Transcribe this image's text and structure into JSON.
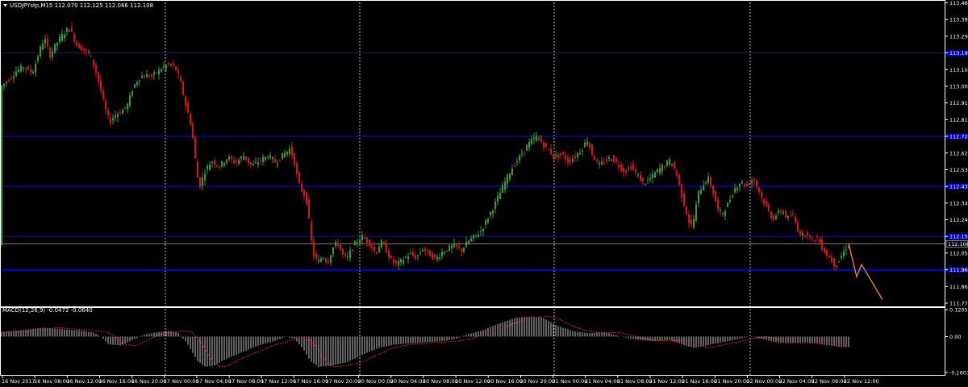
{
  "chart_data": [
    {
      "type": "candlestick",
      "title": "USDJPYstp,M15  112.070 112.125 112.066 112.108",
      "symbol": "USDJPYstp",
      "timeframe": "M15",
      "ohlc_header": [
        112.07,
        112.125,
        112.066,
        112.108
      ],
      "current_price": 112.108,
      "ylim": [
        111.77,
        113.48
      ],
      "y_ticks": [
        "113.480",
        "113.385",
        "113.290",
        "113.195",
        "113.100",
        "113.005",
        "112.910",
        "112.815",
        "112.720",
        "112.625",
        "112.530",
        "112.435",
        "112.340",
        "112.245",
        "112.150",
        "112.055",
        "111.960",
        "111.865",
        "111.770"
      ],
      "x_labels": [
        "16 Nov 2017",
        "16 Nov 08:00",
        "16 Nov 12:00",
        "16 Nov 16:00",
        "16 Nov 20:00",
        "17 Nov 00:00",
        "17 Nov 04:00",
        "17 Nov 08:00",
        "17 Nov 12:00",
        "17 Nov 16:00",
        "17 Nov 20:00",
        "20 Nov 00:00",
        "20 Nov 04:00",
        "20 Nov 08:00",
        "20 Nov 12:00",
        "20 Nov 16:00",
        "20 Nov 20:00",
        "21 Nov 00:00",
        "21 Nov 04:00",
        "21 Nov 08:00",
        "21 Nov 12:00",
        "21 Nov 16:00",
        "21 Nov 20:00",
        "22 Nov 00:00",
        "22 Nov 04:00",
        "22 Nov 08:00",
        "22 Nov 12:00"
      ],
      "period_separators": [
        "17 Nov 00:00",
        "20 Nov 00:00",
        "20 Nov 20:00",
        "22 Nov 00:00"
      ],
      "horizontal_levels": [
        113.195,
        112.72,
        112.435,
        112.15,
        111.96
      ],
      "price_path": [
        [
          0,
          113.0
        ],
        [
          10,
          113.04
        ],
        [
          20,
          113.09
        ],
        [
          30,
          113.12
        ],
        [
          40,
          113.08
        ],
        [
          50,
          113.22
        ],
        [
          55,
          113.28
        ],
        [
          62,
          113.18
        ],
        [
          70,
          113.25
        ],
        [
          78,
          113.3
        ],
        [
          86,
          113.34
        ],
        [
          95,
          113.24
        ],
        [
          105,
          113.21
        ],
        [
          112,
          113.18
        ],
        [
          118,
          113.1
        ],
        [
          124,
          113.0
        ],
        [
          130,
          112.88
        ],
        [
          136,
          112.8
        ],
        [
          142,
          112.84
        ],
        [
          150,
          112.86
        ],
        [
          158,
          112.9
        ],
        [
          165,
          113.0
        ],
        [
          172,
          113.05
        ],
        [
          180,
          113.07
        ],
        [
          188,
          113.06
        ],
        [
          196,
          113.09
        ],
        [
          204,
          113.12
        ],
        [
          212,
          113.13
        ],
        [
          218,
          113.1
        ],
        [
          224,
          113.02
        ],
        [
          230,
          112.9
        ],
        [
          236,
          112.8
        ],
        [
          240,
          112.68
        ],
        [
          244,
          112.5
        ],
        [
          248,
          112.44
        ],
        [
          254,
          112.52
        ],
        [
          262,
          112.58
        ],
        [
          272,
          112.55
        ],
        [
          282,
          112.6
        ],
        [
          292,
          112.57
        ],
        [
          302,
          112.61
        ],
        [
          312,
          112.55
        ],
        [
          322,
          112.58
        ],
        [
          332,
          112.61
        ],
        [
          342,
          112.57
        ],
        [
          352,
          112.62
        ],
        [
          360,
          112.65
        ],
        [
          366,
          112.55
        ],
        [
          370,
          112.45
        ],
        [
          376,
          112.4
        ],
        [
          380,
          112.35
        ],
        [
          384,
          112.2
        ],
        [
          388,
          112.05
        ],
        [
          394,
          112.0
        ],
        [
          400,
          112.04
        ],
        [
          406,
          112.0
        ],
        [
          412,
          112.08
        ],
        [
          418,
          112.12
        ],
        [
          424,
          112.05
        ],
        [
          430,
          112.02
        ],
        [
          436,
          112.08
        ],
        [
          442,
          112.12
        ],
        [
          448,
          112.15
        ],
        [
          454,
          112.13
        ],
        [
          460,
          112.1
        ],
        [
          466,
          112.05
        ],
        [
          472,
          112.12
        ],
        [
          478,
          112.08
        ],
        [
          484,
          112.02
        ],
        [
          492,
          111.99
        ],
        [
          500,
          112.02
        ],
        [
          508,
          112.05
        ],
        [
          516,
          112.03
        ],
        [
          524,
          112.08
        ],
        [
          532,
          112.05
        ],
        [
          540,
          112.02
        ],
        [
          548,
          112.06
        ],
        [
          556,
          112.08
        ],
        [
          564,
          112.1
        ],
        [
          572,
          112.07
        ],
        [
          580,
          112.12
        ],
        [
          588,
          112.15
        ],
        [
          596,
          112.18
        ],
        [
          604,
          112.25
        ],
        [
          612,
          112.32
        ],
        [
          620,
          112.4
        ],
        [
          628,
          112.48
        ],
        [
          636,
          112.55
        ],
        [
          644,
          112.6
        ],
        [
          652,
          112.66
        ],
        [
          660,
          112.7
        ],
        [
          666,
          112.72
        ],
        [
          672,
          112.68
        ],
        [
          680,
          112.64
        ],
        [
          688,
          112.6
        ],
        [
          696,
          112.62
        ],
        [
          704,
          112.58
        ],
        [
          712,
          112.6
        ],
        [
          720,
          112.64
        ],
        [
          728,
          112.7
        ],
        [
          734,
          112.62
        ],
        [
          742,
          112.55
        ],
        [
          750,
          112.58
        ],
        [
          758,
          112.6
        ],
        [
          766,
          112.56
        ],
        [
          774,
          112.52
        ],
        [
          782,
          112.55
        ],
        [
          790,
          112.5
        ],
        [
          798,
          112.45
        ],
        [
          806,
          112.48
        ],
        [
          814,
          112.52
        ],
        [
          822,
          112.55
        ],
        [
          830,
          112.58
        ],
        [
          838,
          112.52
        ],
        [
          844,
          112.4
        ],
        [
          850,
          112.3
        ],
        [
          856,
          112.2
        ],
        [
          860,
          112.25
        ],
        [
          866,
          112.4
        ],
        [
          872,
          112.45
        ],
        [
          878,
          112.48
        ],
        [
          884,
          112.4
        ],
        [
          890,
          112.3
        ],
        [
          896,
          112.28
        ],
        [
          904,
          112.35
        ],
        [
          910,
          112.42
        ],
        [
          918,
          112.46
        ],
        [
          926,
          112.44
        ],
        [
          934,
          112.48
        ],
        [
          940,
          112.42
        ],
        [
          946,
          112.35
        ],
        [
          952,
          112.3
        ],
        [
          958,
          112.25
        ],
        [
          964,
          112.28
        ],
        [
          970,
          112.3
        ],
        [
          976,
          112.25
        ],
        [
          982,
          112.28
        ],
        [
          988,
          112.2
        ],
        [
          994,
          112.15
        ],
        [
          1000,
          112.18
        ],
        [
          1006,
          112.12
        ],
        [
          1012,
          112.15
        ],
        [
          1018,
          112.1
        ],
        [
          1024,
          112.05
        ],
        [
          1030,
          112.02
        ],
        [
          1036,
          111.98
        ],
        [
          1042,
          112.03
        ],
        [
          1048,
          112.08
        ],
        [
          1052,
          112.1
        ]
      ],
      "forecast_path": [
        [
          1052,
          112.11
        ],
        [
          1062,
          111.92
        ],
        [
          1068,
          111.99
        ],
        [
          1094,
          111.79
        ]
      ],
      "colors": {
        "background": "#000000",
        "up_candle": "#2ea02e",
        "down_candle": "#e01010",
        "level_line": "#0000ff",
        "grid_separator": "#c0c0c0",
        "forecast": "#ff8c00",
        "macd_histogram": "#c0c0c0",
        "macd_signal": "#ff2020",
        "current_price_line": "#808080"
      }
    },
    {
      "type": "bar",
      "title": "MACD(12,26,9) -0.0472 -0.0640",
      "indicator": "MACD",
      "parameters": [
        12,
        26,
        9
      ],
      "main_value": -0.0472,
      "signal_value": -0.064,
      "ylim": [
        -0.1603,
        0.1205
      ],
      "y_ticks": [
        "0.1205",
        "0.00",
        "-0.1603"
      ],
      "histogram_path": [
        [
          0,
          0.02
        ],
        [
          30,
          0.03
        ],
        [
          55,
          0.04
        ],
        [
          70,
          0.035
        ],
        [
          95,
          0.028
        ],
        [
          115,
          0.02
        ],
        [
          125,
          0.0
        ],
        [
          135,
          -0.035
        ],
        [
          150,
          -0.04
        ],
        [
          165,
          -0.015
        ],
        [
          180,
          0.01
        ],
        [
          195,
          0.02
        ],
        [
          210,
          0.025
        ],
        [
          220,
          0.02
        ],
        [
          232,
          -0.03
        ],
        [
          245,
          -0.11
        ],
        [
          255,
          -0.135
        ],
        [
          265,
          -0.13
        ],
        [
          280,
          -0.1
        ],
        [
          300,
          -0.07
        ],
        [
          320,
          -0.04
        ],
        [
          340,
          -0.02
        ],
        [
          355,
          0.0
        ],
        [
          365,
          -0.01
        ],
        [
          375,
          -0.05
        ],
        [
          385,
          -0.11
        ],
        [
          395,
          -0.135
        ],
        [
          410,
          -0.13
        ],
        [
          430,
          -0.115
        ],
        [
          450,
          -0.08
        ],
        [
          470,
          -0.05
        ],
        [
          490,
          -0.035
        ],
        [
          510,
          -0.03
        ],
        [
          530,
          -0.025
        ],
        [
          550,
          -0.02
        ],
        [
          565,
          -0.01
        ],
        [
          580,
          0.01
        ],
        [
          600,
          0.03
        ],
        [
          620,
          0.06
        ],
        [
          640,
          0.085
        ],
        [
          660,
          0.09
        ],
        [
          672,
          0.085
        ],
        [
          690,
          0.05
        ],
        [
          710,
          0.025
        ],
        [
          730,
          0.015
        ],
        [
          750,
          0.02
        ],
        [
          770,
          0.0
        ],
        [
          790,
          -0.015
        ],
        [
          810,
          -0.02
        ],
        [
          830,
          -0.015
        ],
        [
          850,
          -0.04
        ],
        [
          860,
          -0.05
        ],
        [
          875,
          -0.04
        ],
        [
          895,
          -0.025
        ],
        [
          915,
          -0.01
        ],
        [
          930,
          0.0
        ],
        [
          945,
          -0.01
        ],
        [
          960,
          -0.025
        ],
        [
          980,
          -0.03
        ],
        [
          1000,
          -0.025
        ],
        [
          1020,
          -0.035
        ],
        [
          1040,
          -0.045
        ],
        [
          1052,
          -0.047
        ]
      ]
    }
  ]
}
